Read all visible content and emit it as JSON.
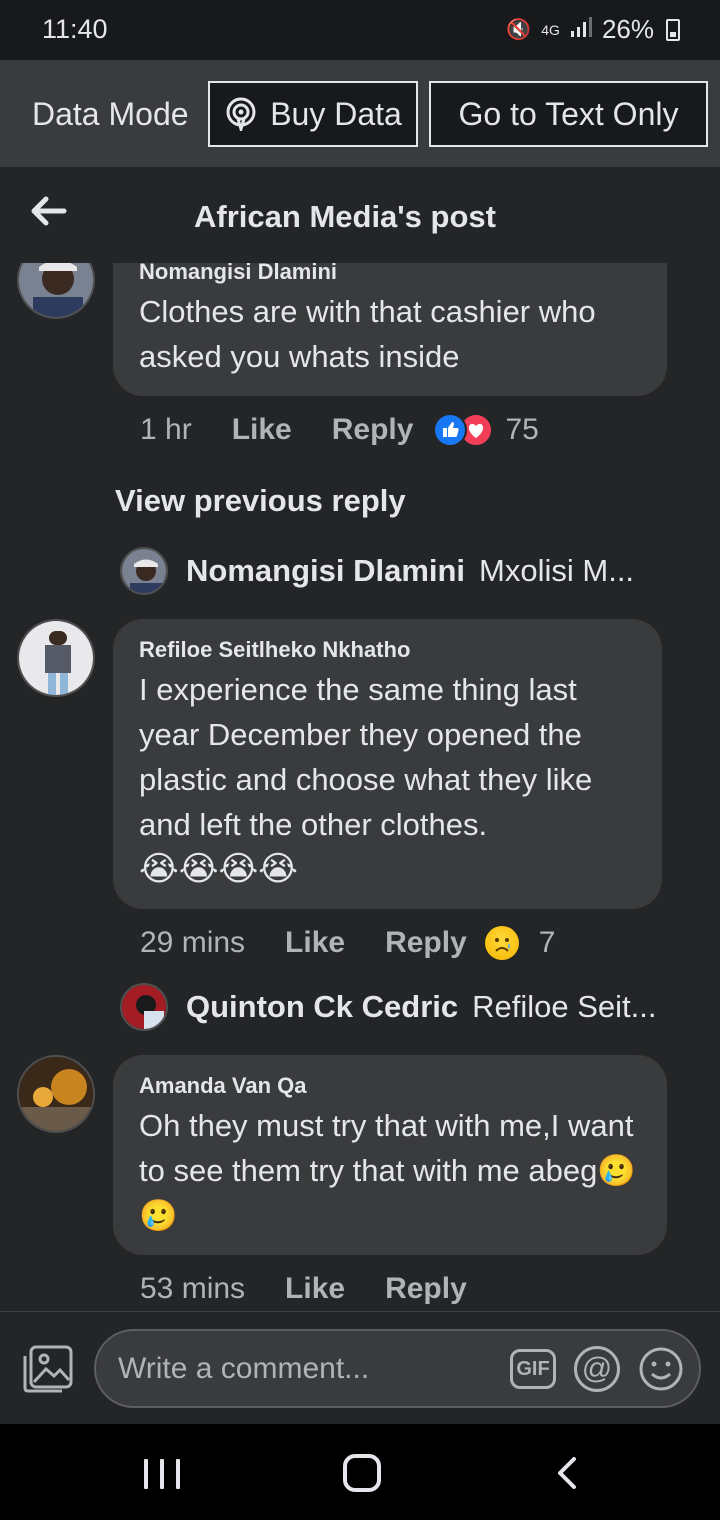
{
  "status_bar": {
    "time": "11:40",
    "network": "4G",
    "battery": "26%"
  },
  "data_bar": {
    "mode_label": "Data Mode",
    "buy_label": "Buy Data",
    "text_only_label": "Go to Text Only"
  },
  "header": {
    "title": "African Media's post"
  },
  "comments": [
    {
      "author": "Nomangisi Dlamini",
      "text": "Clothes are with that cashier who asked you whats inside",
      "time": "1 hr",
      "like": "Like",
      "reply": "Reply",
      "reactions": [
        "like",
        "love"
      ],
      "reaction_count": "75"
    },
    {
      "author": "Refiloe Seitlheko Nkhatho",
      "text": "I experience the same thing last year December they opened the plastic and choose what they like and left the other clothes.",
      "emoji": "😭😭😭😭",
      "time": "29 mins",
      "like": "Like",
      "reply": "Reply",
      "reactions": [
        "sad"
      ],
      "reaction_count": "7"
    },
    {
      "author": "Amanda Van Qa",
      "text": "Oh they must try that with  me,I want to see them try that with me abeg",
      "emoji": "🥲🥲",
      "time": "53 mins",
      "like": "Like",
      "reply": "Reply"
    }
  ],
  "view_previous": "View previous reply",
  "reply_previews": [
    {
      "name": "Nomangisi Dlamini",
      "text": "Mxolisi M..."
    },
    {
      "name": "Quinton Ck Cedric",
      "text": "Refiloe Seit..."
    }
  ],
  "composer": {
    "placeholder": "Write a comment...",
    "gif_label": "GIF",
    "at_label": "@"
  },
  "colors": {
    "background": "#242526",
    "bubble": "#3a3b3c",
    "like_blue": "#1877f2",
    "love_red": "#f33e58"
  }
}
